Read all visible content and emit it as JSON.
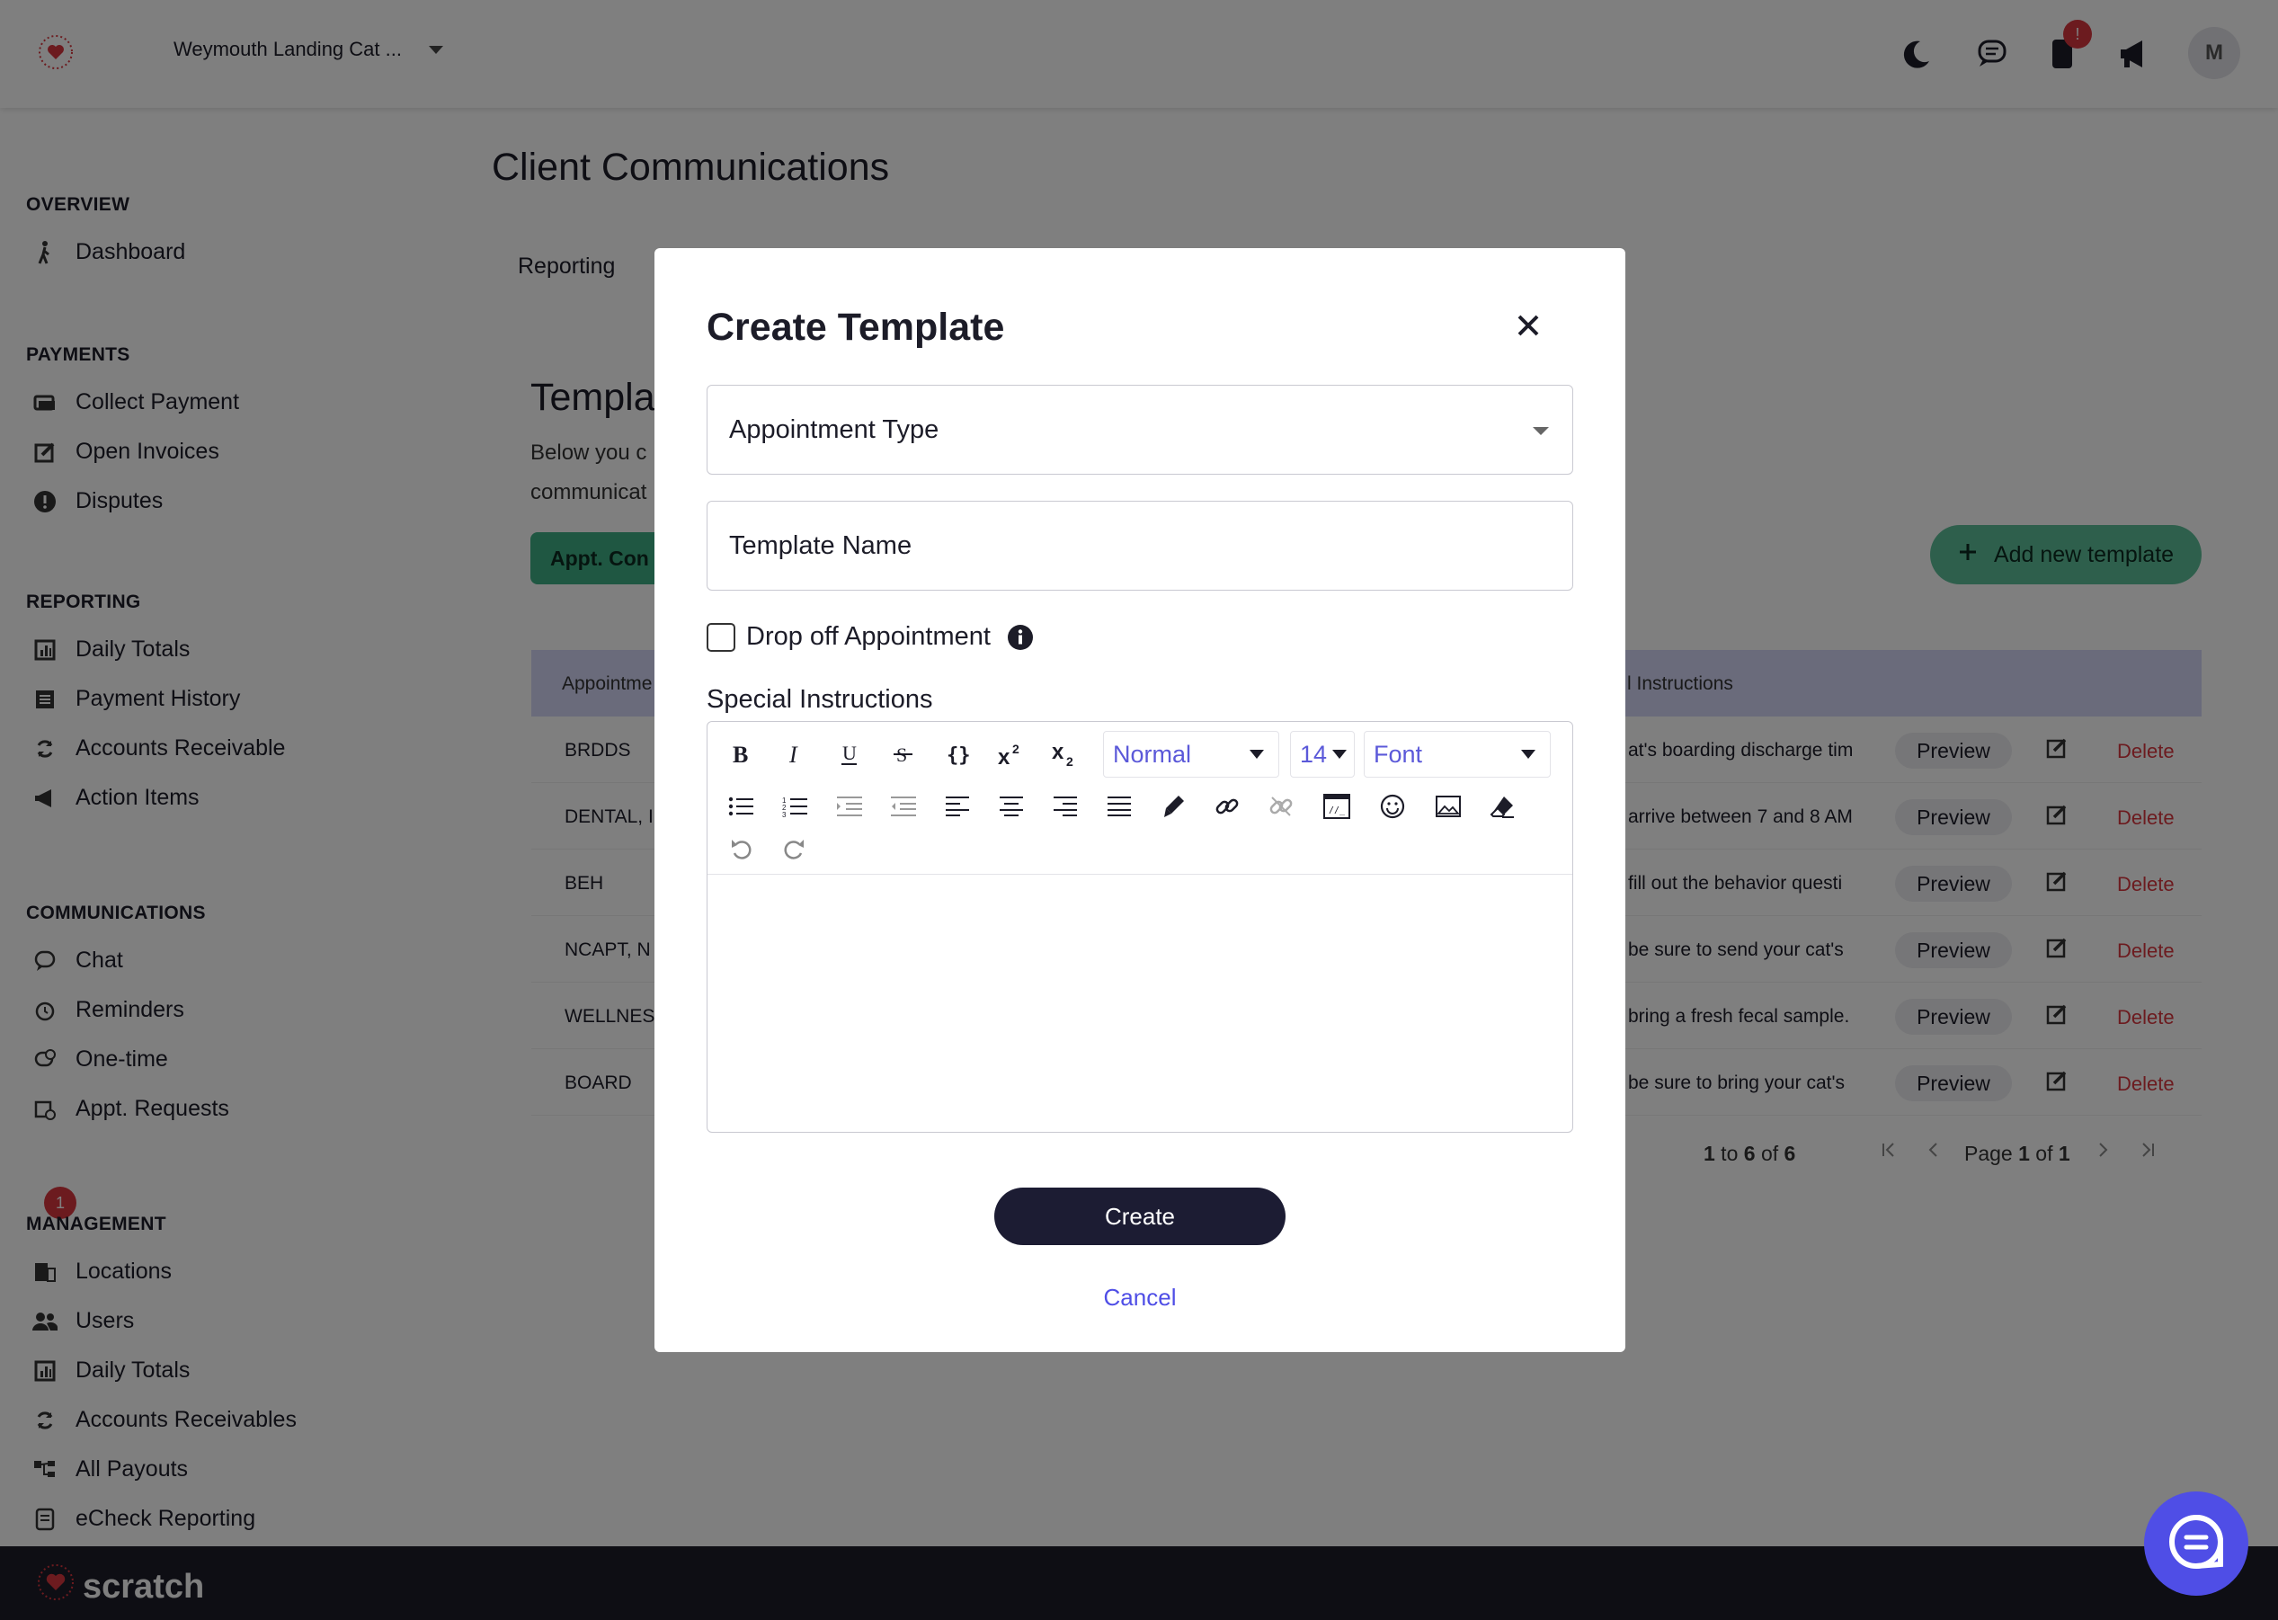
{
  "header": {
    "org_name": "Weymouth Landing Cat ...",
    "notification_badge": "!",
    "avatar_initial": "M"
  },
  "sidebar": {
    "sections": [
      {
        "title": "OVERVIEW",
        "items": [
          {
            "label": "Dashboard",
            "icon": "person-walking-icon"
          }
        ]
      },
      {
        "title": "PAYMENTS",
        "items": [
          {
            "label": "Collect Payment",
            "icon": "card-icon"
          },
          {
            "label": "Open Invoices",
            "icon": "edit-icon"
          },
          {
            "label": "Disputes",
            "icon": "alert-circle-icon"
          }
        ]
      },
      {
        "title": "REPORTING",
        "items": [
          {
            "label": "Daily Totals",
            "icon": "chart-icon"
          },
          {
            "label": "Payment History",
            "icon": "list-icon"
          },
          {
            "label": "Accounts Receivable",
            "icon": "refresh-icon"
          },
          {
            "label": "Action Items",
            "icon": "megaphone-icon"
          }
        ]
      },
      {
        "title": "COMMUNICATIONS",
        "items": [
          {
            "label": "Chat",
            "icon": "chat-icon"
          },
          {
            "label": "Reminders",
            "icon": "alarm-icon"
          },
          {
            "label": "One-time",
            "icon": "chat-plus-icon"
          },
          {
            "label": "Appt. Requests",
            "icon": "calendar-clock-icon"
          }
        ]
      },
      {
        "title": "MANAGEMENT",
        "items": [
          {
            "label": "Locations",
            "icon": "building-icon"
          },
          {
            "label": "Users",
            "icon": "users-icon"
          },
          {
            "label": "Daily Totals",
            "icon": "chart-icon"
          },
          {
            "label": "Accounts Receivables",
            "icon": "refresh-icon"
          },
          {
            "label": "All Payouts",
            "icon": "flow-icon"
          },
          {
            "label": "eCheck Reporting",
            "icon": "document-icon"
          }
        ]
      }
    ],
    "appt_requests_badge": "1"
  },
  "main": {
    "page_title": "Client Communications",
    "tab_reporting": "Reporting",
    "section_title": "Templa",
    "section_desc_1": "Below you c",
    "section_desc_2": "communicat",
    "filter_chip": "Appt. Con",
    "add_button": "Add new template",
    "table": {
      "col_appointment": "Appointme",
      "col_instructions": "l Instructions",
      "rows": [
        {
          "name": "BRDDS",
          "instr": "at's boarding discharge tim"
        },
        {
          "name": "DENTAL, I",
          "instr": "arrive between 7 and 8 AM"
        },
        {
          "name": "BEH",
          "instr": "fill out the behavior questi"
        },
        {
          "name": "NCAPT, N",
          "instr": "be sure to send your cat's"
        },
        {
          "name": "WELLNES",
          "instr": "bring a fresh fecal sample."
        },
        {
          "name": "BOARD",
          "instr": "be sure to bring your cat's"
        }
      ],
      "preview_label": "Preview",
      "delete_label": "Delete"
    },
    "pager": {
      "range_pre": "1",
      "range_to": " to ",
      "range_end": "6",
      "range_of": " of ",
      "range_total": "6",
      "page_pre": "Page ",
      "page_num": "1",
      "page_of": " of ",
      "page_total": "1"
    }
  },
  "modal": {
    "title": "Create Template",
    "appointment_type_placeholder": "Appointment Type",
    "template_name_placeholder": "Template Name",
    "drop_off_label": "Drop off Appointment",
    "special_instructions_label": "Special Instructions",
    "editor": {
      "style_select": "Normal",
      "size_select": "14",
      "font_select": "Font"
    },
    "create_label": "Create",
    "cancel_label": "Cancel"
  },
  "footer": {
    "brand": "scratch"
  },
  "colors": {
    "accent": "#4f4ee6",
    "green": "#5dbf98",
    "danger": "#d9363e",
    "dark": "#1c1c33"
  }
}
